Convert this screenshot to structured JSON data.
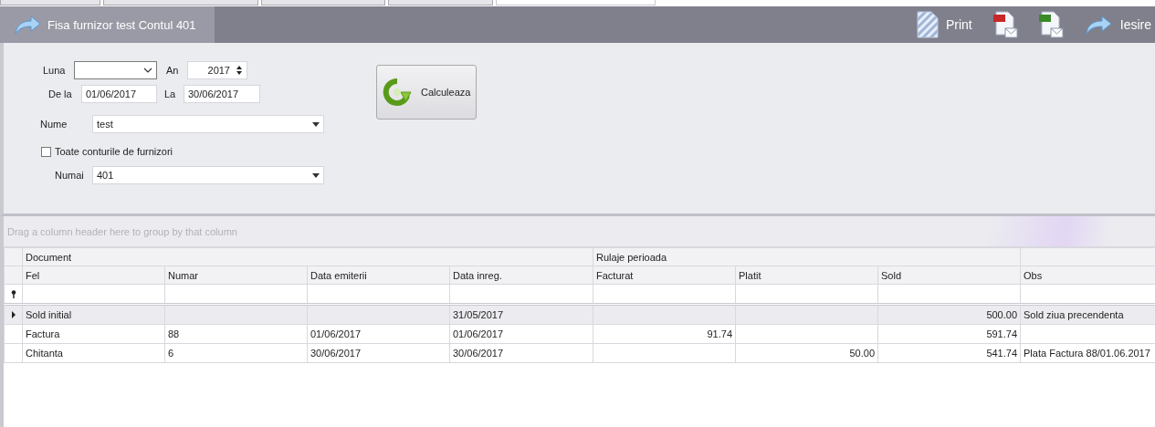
{
  "tabs": [
    {
      "selected": false
    },
    {
      "selected": false
    },
    {
      "selected": false
    },
    {
      "selected": false
    },
    {
      "selected": true
    }
  ],
  "header": {
    "title": "Fisa furnizor test Contul 401",
    "actions": [
      {
        "kind": "print",
        "label": "Print"
      },
      {
        "kind": "pdf"
      },
      {
        "kind": "xls"
      },
      {
        "kind": "exit",
        "label": "Iesire"
      }
    ]
  },
  "form": {
    "month": {
      "label": "Luna"
    },
    "year": {
      "label": "An",
      "value": "2017"
    },
    "from": {
      "label": "De la",
      "value": "01/06/2017"
    },
    "to": {
      "label": "La",
      "value": "30/06/2017"
    },
    "name": {
      "label": "Nume",
      "value": "test"
    },
    "all_accounts": {
      "label": "Toate conturile de furnizori",
      "checked": false
    },
    "account": {
      "label": "Numai",
      "value": "401"
    },
    "calculate_button": "Calculeaza"
  },
  "grid": {
    "group_panel": "Drag a column header here to group by that column",
    "bands": [
      "Document",
      "Rulaje perioada"
    ],
    "columns": [
      "Fel",
      "Numar",
      "Data emiterii",
      "Data inreg.",
      "Facturat",
      "Platit",
      "Sold",
      "Obs"
    ],
    "rows": [
      {
        "selected": true,
        "cells": [
          "Sold initial",
          "",
          "",
          "31/05/2017",
          "",
          "",
          "500.00",
          "Sold ziua precendenta"
        ]
      },
      {
        "selected": false,
        "cells": [
          "Factura",
          "88",
          "01/06/2017",
          "01/06/2017",
          "91.74",
          "",
          "591.74",
          ""
        ]
      },
      {
        "selected": false,
        "cells": [
          "Chitanta",
          "6",
          "30/06/2017",
          "30/06/2017",
          "",
          "50.00",
          "541.74",
          "Plata Factura 88/01.06.2017"
        ]
      }
    ]
  }
}
